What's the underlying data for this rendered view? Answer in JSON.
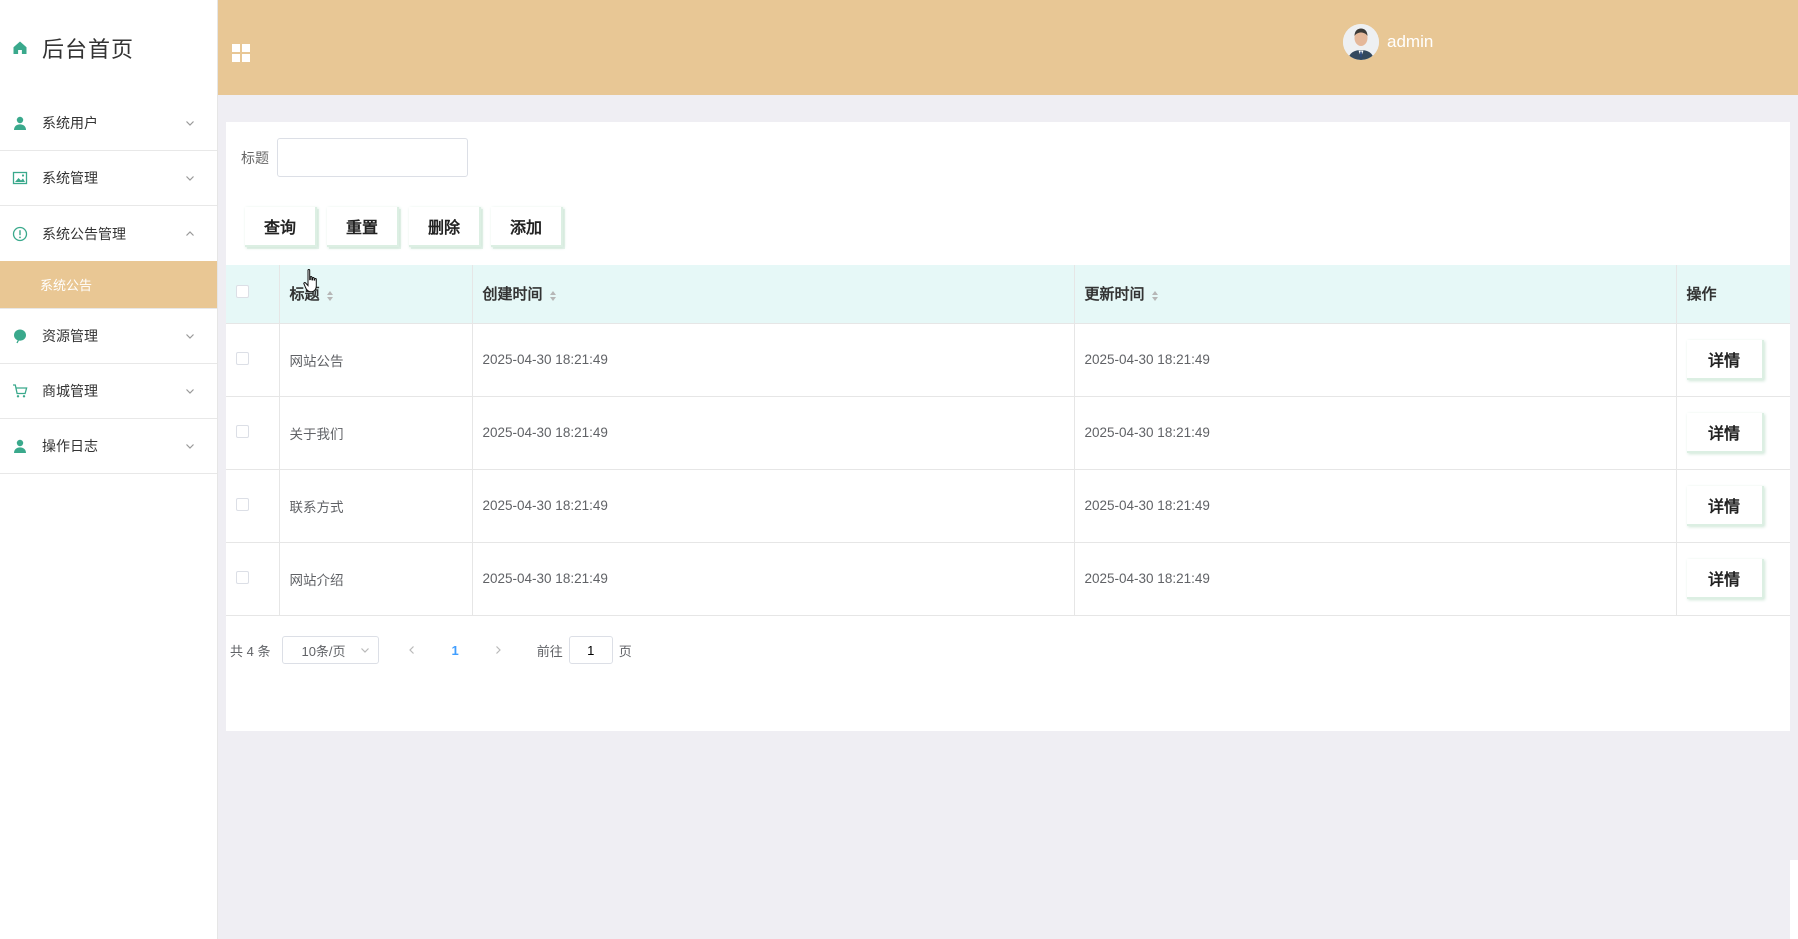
{
  "sidebar": {
    "brand_title": "后台首页",
    "items": [
      {
        "label": "系统用户",
        "icon": "user-icon"
      },
      {
        "label": "系统管理",
        "icon": "image-icon"
      },
      {
        "label": "系统公告管理",
        "icon": "info-circle-icon",
        "expanded": true,
        "children": [
          {
            "label": "系统公告",
            "active": true
          }
        ]
      },
      {
        "label": "资源管理",
        "icon": "leaf-icon"
      },
      {
        "label": "商城管理",
        "icon": "cart-icon"
      },
      {
        "label": "操作日志",
        "icon": "user-icon"
      }
    ]
  },
  "header": {
    "menu_icon": "grid-icon",
    "username": "admin"
  },
  "search": {
    "label": "标题",
    "value": "",
    "placeholder": ""
  },
  "toolbar": {
    "query_label": "查询",
    "reset_label": "重置",
    "delete_label": "删除",
    "add_label": "添加"
  },
  "table": {
    "columns": {
      "title": "标题",
      "created": "创建时间",
      "updated": "更新时间",
      "ops": "操作"
    },
    "detail_label": "详情",
    "rows": [
      {
        "title": "网站公告",
        "created": "2025-04-30 18:21:49",
        "updated": "2025-04-30 18:21:49"
      },
      {
        "title": "关于我们",
        "created": "2025-04-30 18:21:49",
        "updated": "2025-04-30 18:21:49"
      },
      {
        "title": "联系方式",
        "created": "2025-04-30 18:21:49",
        "updated": "2025-04-30 18:21:49"
      },
      {
        "title": "网站介绍",
        "created": "2025-04-30 18:21:49",
        "updated": "2025-04-30 18:21:49"
      }
    ]
  },
  "pagination": {
    "total_text": "共 4 条",
    "page_size": "10条/页",
    "current_page": "1",
    "goto_prefix": "前往",
    "goto_value": "1",
    "goto_suffix": "页"
  },
  "colors": {
    "header_bg": "#e8c795",
    "active_menu_bg": "#e9c794",
    "icon_green": "#3aa98c",
    "table_header_bg": "#e6f8f7",
    "page_bg": "#efeef3",
    "current_page": "#409eff"
  }
}
